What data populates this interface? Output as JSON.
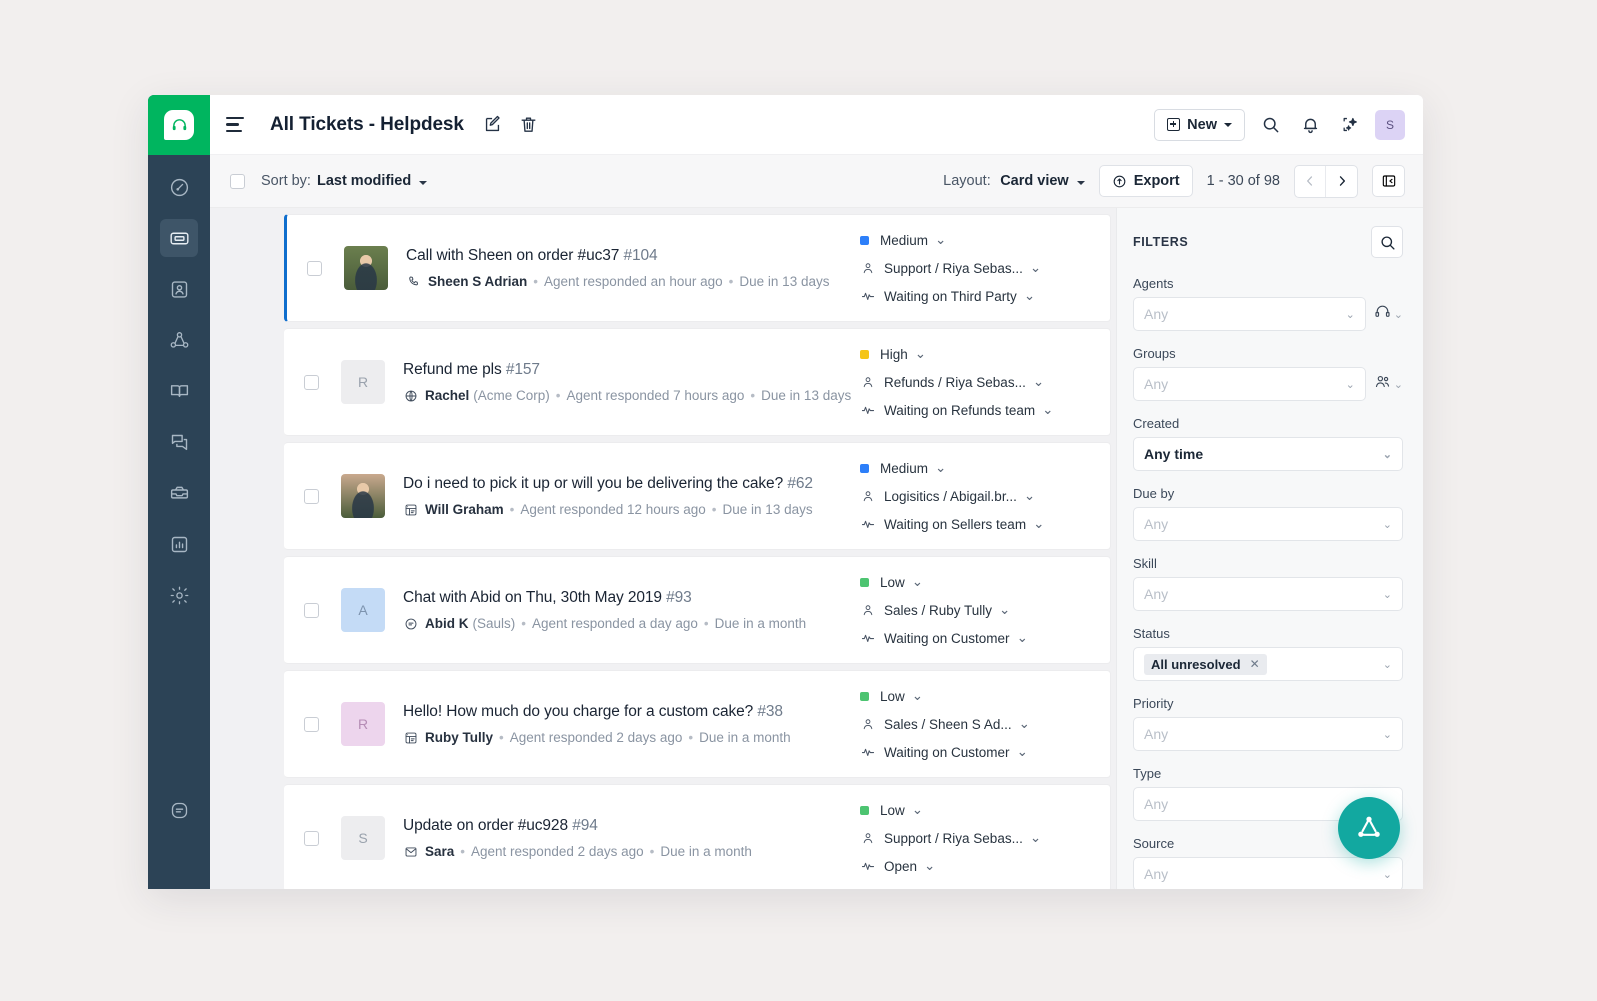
{
  "app": {
    "brand_color": "#00b55f",
    "rail_color": "#2c4356",
    "accent_blue": "#0f6ecd",
    "fab_color": "#12a8a0"
  },
  "sidebar": {
    "logo_icon": "headset-icon",
    "items": [
      {
        "icon": "dashboard-gauge-icon",
        "name": "sidebar-item-dashboard",
        "active": false
      },
      {
        "icon": "ticket-icon",
        "name": "sidebar-item-tickets",
        "active": true
      },
      {
        "icon": "contact-card-icon",
        "name": "sidebar-item-contacts",
        "active": false
      },
      {
        "icon": "network-nodes-icon",
        "name": "sidebar-item-customers",
        "active": false
      },
      {
        "icon": "book-icon",
        "name": "sidebar-item-knowledge-base",
        "active": false
      },
      {
        "icon": "chat-bubbles-icon",
        "name": "sidebar-item-chat",
        "active": false
      },
      {
        "icon": "inbox-tray-icon",
        "name": "sidebar-item-automations",
        "active": false
      },
      {
        "icon": "bar-chart-icon",
        "name": "sidebar-item-analytics",
        "active": false
      },
      {
        "icon": "gear-icon",
        "name": "sidebar-item-settings",
        "active": false
      }
    ],
    "bottom_item": {
      "icon": "freshchat-badge-icon",
      "name": "sidebar-item-freshchat"
    }
  },
  "header": {
    "menu_icon": "hamburger-icon",
    "title": "All Tickets - Helpdesk",
    "edit_icon": "edit-pencil-icon",
    "delete_icon": "trash-icon",
    "new_label": "New",
    "search_icon": "search-icon",
    "bell_icon": "bell-icon",
    "sparkle_icon": "ai-sparkle-icon",
    "avatar_initial": "S"
  },
  "toolbar": {
    "sort_label": "Sort by:",
    "sort_value": "Last modified",
    "layout_label": "Layout:",
    "layout_value": "Card view",
    "export_label": "Export",
    "export_icon": "export-upload-icon",
    "page_range": "1 - 30 of 98",
    "prev_icon": "chevron-left-icon",
    "next_icon": "chevron-right-icon",
    "collapse_icon": "collapse-panel-icon"
  },
  "tickets": [
    {
      "selected": true,
      "title": "Call with Sheen on order #uc37",
      "number": "#104",
      "channel_icon": "phone-icon",
      "requester": "Sheen S Adrian",
      "org": "",
      "activity": "Agent responded an hour ago",
      "due": "Due in 13 days",
      "priority": "Medium",
      "priority_color": "#2d7ff9",
      "assignee": "Support / Riya Sebas...",
      "status": "Waiting on Third Party",
      "avatar_type": "photo",
      "avatar_initial": "",
      "avatar_bg": "#6b7f4e",
      "avatar_fg": "#ffffff"
    },
    {
      "selected": false,
      "title": "Refund me pls",
      "number": "#157",
      "channel_icon": "portal-globe-icon",
      "requester": "Rachel",
      "org": "(Acme Corp)",
      "activity": "Agent responded 7 hours ago",
      "due": "Due in 13 days",
      "priority": "High",
      "priority_color": "#f5c518",
      "assignee": "Refunds / Riya Sebas...",
      "status": "Waiting on Refunds team",
      "avatar_type": "initial",
      "avatar_initial": "R",
      "avatar_bg": "#ededef",
      "avatar_fg": "#9aa2ad"
    },
    {
      "selected": false,
      "title": "Do i need to pick it up or will you be delivering the cake?",
      "number": "#62",
      "channel_icon": "feedback-widget-icon",
      "requester": "Will Graham",
      "org": "",
      "activity": "Agent responded 12 hours ago",
      "due": "Due in 13 days",
      "priority": "Medium",
      "priority_color": "#2d7ff9",
      "assignee": "Logisitics / Abigail.br...",
      "status": "Waiting on Sellers team",
      "avatar_type": "photo",
      "avatar_initial": "",
      "avatar_bg": "#c9a98e",
      "avatar_fg": "#ffffff"
    },
    {
      "selected": false,
      "title": "Chat with Abid on Thu, 30th May 2019",
      "number": "#93",
      "channel_icon": "chat-icon",
      "requester": "Abid K",
      "org": "(Sauls)",
      "activity": "Agent responded a day ago",
      "due": "Due in a month",
      "priority": "Low",
      "priority_color": "#4dc471",
      "assignee": "Sales / Ruby Tully",
      "status": "Waiting on Customer",
      "avatar_type": "initial",
      "avatar_initial": "A",
      "avatar_bg": "#c4dbf6",
      "avatar_fg": "#7d93ae"
    },
    {
      "selected": false,
      "title": "Hello! How much do you charge for a custom cake?",
      "number": "#38",
      "channel_icon": "feedback-widget-icon",
      "requester": "Ruby Tully",
      "org": "",
      "activity": "Agent responded 2 days ago",
      "due": "Due in a month",
      "priority": "Low",
      "priority_color": "#4dc471",
      "assignee": "Sales / Sheen S Ad...",
      "status": "Waiting on Customer",
      "avatar_type": "initial",
      "avatar_initial": "R",
      "avatar_bg": "#edd5ed",
      "avatar_fg": "#b58cb5"
    },
    {
      "selected": false,
      "title": "Update on order #uc928",
      "number": "#94",
      "channel_icon": "email-icon",
      "requester": "Sara",
      "org": "",
      "activity": "Agent responded 2 days ago",
      "due": "Due in a month",
      "priority": "Low",
      "priority_color": "#4dc471",
      "assignee": "Support / Riya Sebas...",
      "status": "Open",
      "avatar_type": "initial",
      "avatar_initial": "S",
      "avatar_bg": "#ededef",
      "avatar_fg": "#9aa2ad"
    }
  ],
  "filters": {
    "title": "FILTERS",
    "search_icon": "search-icon",
    "groups": [
      {
        "label": "Agents",
        "value": "",
        "placeholder": "Any",
        "side_icon": "headset-icon",
        "name": "filter-agents"
      },
      {
        "label": "Groups",
        "value": "",
        "placeholder": "Any",
        "side_icon": "people-icon",
        "name": "filter-groups"
      },
      {
        "label": "Created",
        "value": "Any time",
        "placeholder": "Any time",
        "side_icon": "",
        "name": "filter-created"
      },
      {
        "label": "Due by",
        "value": "",
        "placeholder": "Any",
        "side_icon": "",
        "name": "filter-due-by"
      },
      {
        "label": "Skill",
        "value": "",
        "placeholder": "Any",
        "side_icon": "",
        "name": "filter-skill"
      },
      {
        "label": "Status",
        "value": "",
        "placeholder": "Any",
        "side_icon": "",
        "name": "filter-status",
        "chip": "All unresolved"
      },
      {
        "label": "Priority",
        "value": "",
        "placeholder": "Any",
        "side_icon": "",
        "name": "filter-priority"
      },
      {
        "label": "Type",
        "value": "",
        "placeholder": "Any",
        "side_icon": "",
        "name": "filter-type"
      },
      {
        "label": "Source",
        "value": "",
        "placeholder": "Any",
        "side_icon": "",
        "name": "filter-source"
      }
    ]
  },
  "fab": {
    "icon": "freshworks-triangle-icon"
  }
}
